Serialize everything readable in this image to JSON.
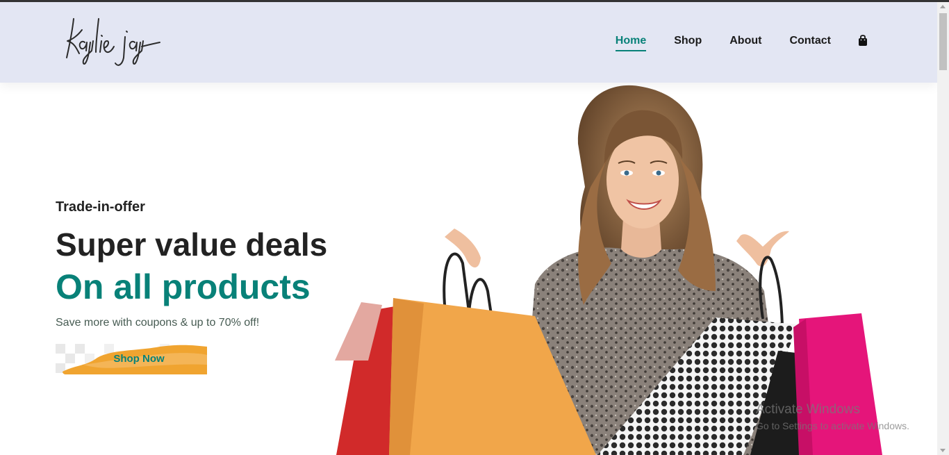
{
  "brand": {
    "logo_text": "kaylie jay"
  },
  "nav": {
    "items": [
      {
        "label": "Home",
        "active": true
      },
      {
        "label": "Shop",
        "active": false
      },
      {
        "label": "About",
        "active": false
      },
      {
        "label": "Contact",
        "active": false
      }
    ],
    "cart_icon": "shopping-bag-icon"
  },
  "hero": {
    "kicker": "Trade-in-offer",
    "headline": "Super value deals",
    "highlight": "On all products",
    "description": "Save more with coupons & up to 70% off!",
    "cta_label": "Shop Now"
  },
  "system": {
    "watermark_title": "Activate Windows",
    "watermark_subtitle": "Go to Settings to activate Windows."
  },
  "colors": {
    "accent": "#088178",
    "header_bg": "#e3e6f3",
    "text_dark": "#222222",
    "button_orange": "#f0a430"
  }
}
